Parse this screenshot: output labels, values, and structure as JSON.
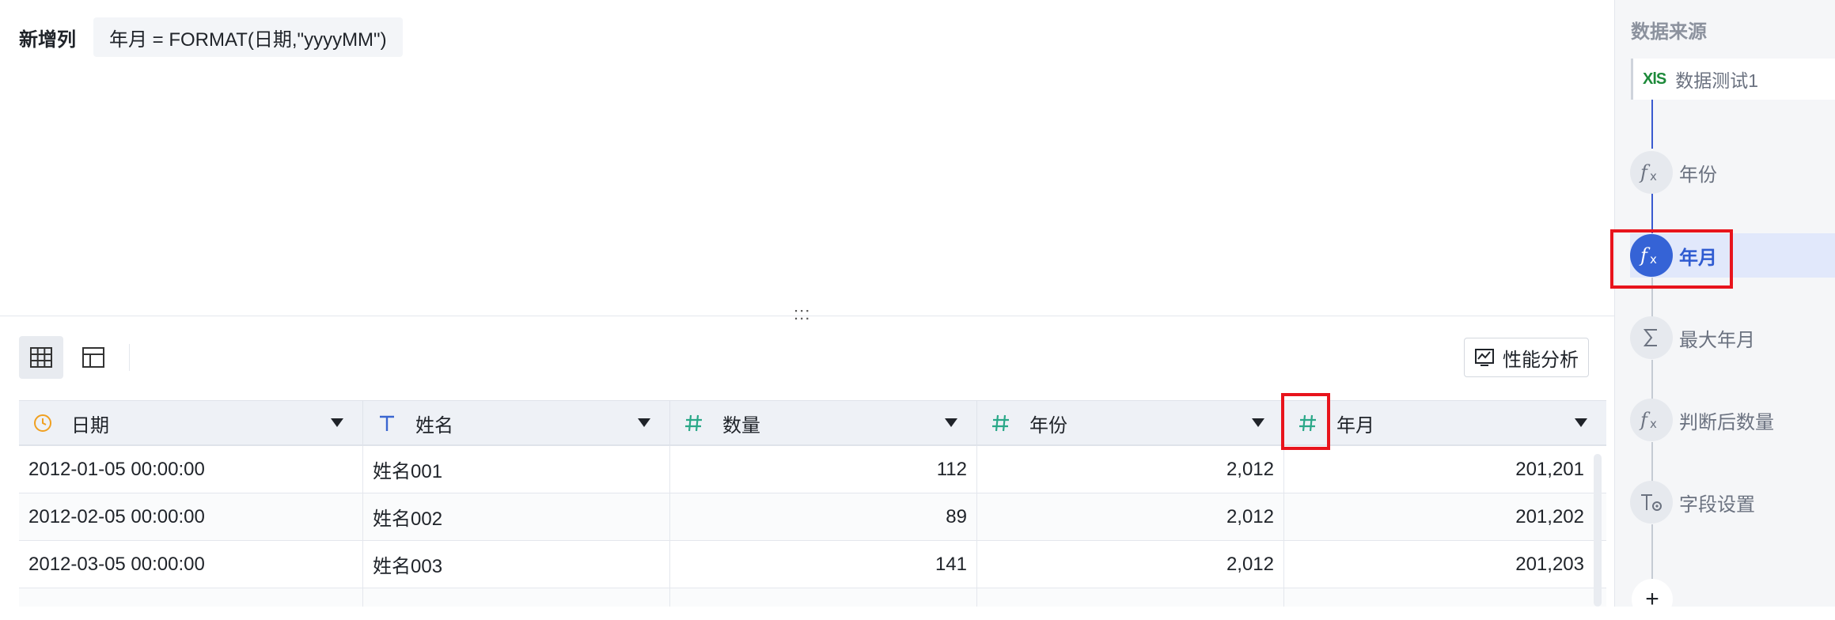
{
  "formula": {
    "label": "新增列",
    "expression": "年月 = FORMAT(日期,\"yyyyMM\")"
  },
  "drag_handle": ":::",
  "toolbar": {
    "perf_button": "性能分析"
  },
  "table": {
    "columns": [
      {
        "name": "日期",
        "type": "date"
      },
      {
        "name": "姓名",
        "type": "text"
      },
      {
        "name": "数量",
        "type": "number"
      },
      {
        "name": "年份",
        "type": "number"
      },
      {
        "name": "年月",
        "type": "number"
      }
    ],
    "rows": [
      [
        "2012-01-05 00:00:00",
        "姓名001",
        "112",
        "2,012",
        "201,201"
      ],
      [
        "2012-02-05 00:00:00",
        "姓名002",
        "89",
        "2,012",
        "201,202"
      ],
      [
        "2012-03-05 00:00:00",
        "姓名003",
        "141",
        "2,012",
        "201,203"
      ]
    ]
  },
  "panel": {
    "title": "数据来源",
    "source": {
      "icon_text": "XlS",
      "label": "数据测试1"
    },
    "steps": [
      {
        "label": "年份",
        "icon": "fx-icon",
        "active": false
      },
      {
        "label": "年月",
        "icon": "fx-icon",
        "active": true
      },
      {
        "label": "最大年月",
        "icon": "sigma-icon",
        "active": false
      },
      {
        "label": "判断后数量",
        "icon": "fx-icon",
        "active": false
      },
      {
        "label": "字段设置",
        "icon": "field-settings-icon",
        "active": false
      }
    ],
    "add_label": "+"
  },
  "colors": {
    "accent": "#3563d6",
    "highlight": "#e8141c",
    "date_icon": "#f0a020",
    "text_icon": "#3a66d0",
    "number_icon": "#2aa888"
  }
}
